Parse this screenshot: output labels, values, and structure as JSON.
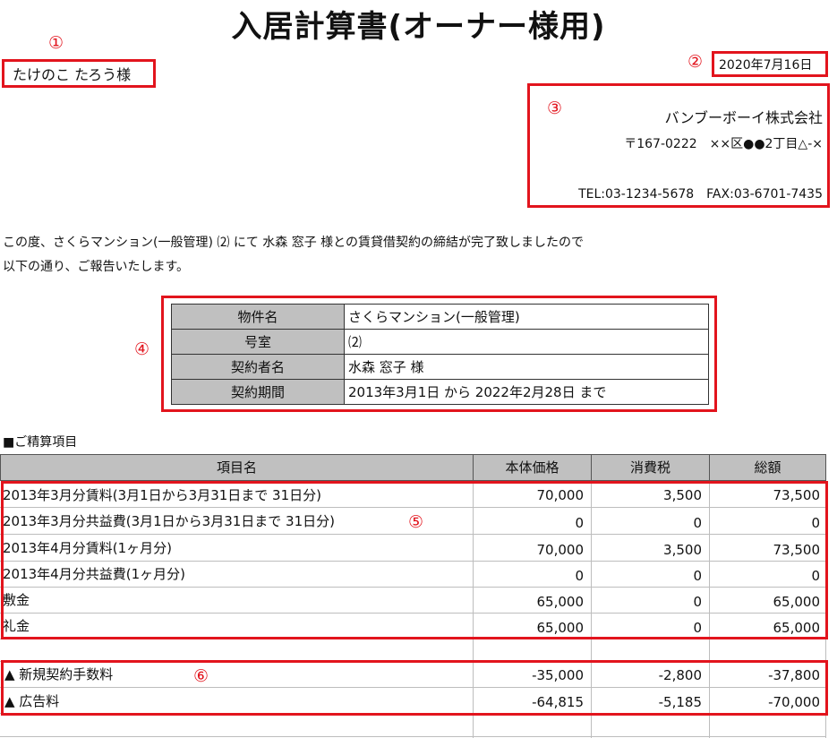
{
  "title": "入居計算書(オーナー様用)",
  "addressee": "たけのこ たろう様",
  "date": "2020年7月16日",
  "sender": {
    "company": "バンブーボーイ株式会社",
    "address": "〒167-0222　××区●●2丁目△-×",
    "phone_fax": "TEL:03-1234-5678　FAX:03-6701-7435"
  },
  "intro": {
    "line1": "この度、さくらマンション(一般管理) ⑵ にて 水森 窓子 様との賃貸借契約の締結が完了致しましたので",
    "line2": "以下の通り、ご報告いたします。"
  },
  "property_info": [
    {
      "label": "物件名",
      "value": "さくらマンション(一般管理)"
    },
    {
      "label": "号室",
      "value": "⑵"
    },
    {
      "label": "契約者名",
      "value": "水森 窓子 様"
    },
    {
      "label": "契約期間",
      "value": "2013年3月1日 から 2022年2月28日 まで"
    }
  ],
  "section_label": "■ご精算項目",
  "table": {
    "headers": [
      "項目名",
      "本体価格",
      "消費税",
      "総額"
    ],
    "rows": [
      {
        "item": "2013年3月分賃料(3月1日から3月31日まで 31日分)",
        "base": "70,000",
        "tax": "3,500",
        "total": "73,500"
      },
      {
        "item": "2013年3月分共益費(3月1日から3月31日まで 31日分)",
        "base": "0",
        "tax": "0",
        "total": "0"
      },
      {
        "item": "2013年4月分賃料(1ヶ月分)",
        "base": "70,000",
        "tax": "3,500",
        "total": "73,500"
      },
      {
        "item": "2013年4月分共益費(1ヶ月分)",
        "base": "0",
        "tax": "0",
        "total": "0"
      },
      {
        "item": "敷金",
        "base": "65,000",
        "tax": "0",
        "total": "65,000"
      },
      {
        "item": "礼金",
        "base": "65,000",
        "tax": "0",
        "total": "65,000"
      }
    ],
    "deductions": [
      {
        "item": "▲ 新規契約手数料",
        "base": "-35,000",
        "tax": "-2,800",
        "total": "-37,800"
      },
      {
        "item": "▲ 広告料",
        "base": "-64,815",
        "tax": "-5,185",
        "total": "-70,000"
      }
    ]
  },
  "markers": [
    "①",
    "②",
    "③",
    "④",
    "⑤",
    "⑥"
  ],
  "colors": {
    "highlight": "#e2141d",
    "header_fill": "#c0c0c0"
  }
}
